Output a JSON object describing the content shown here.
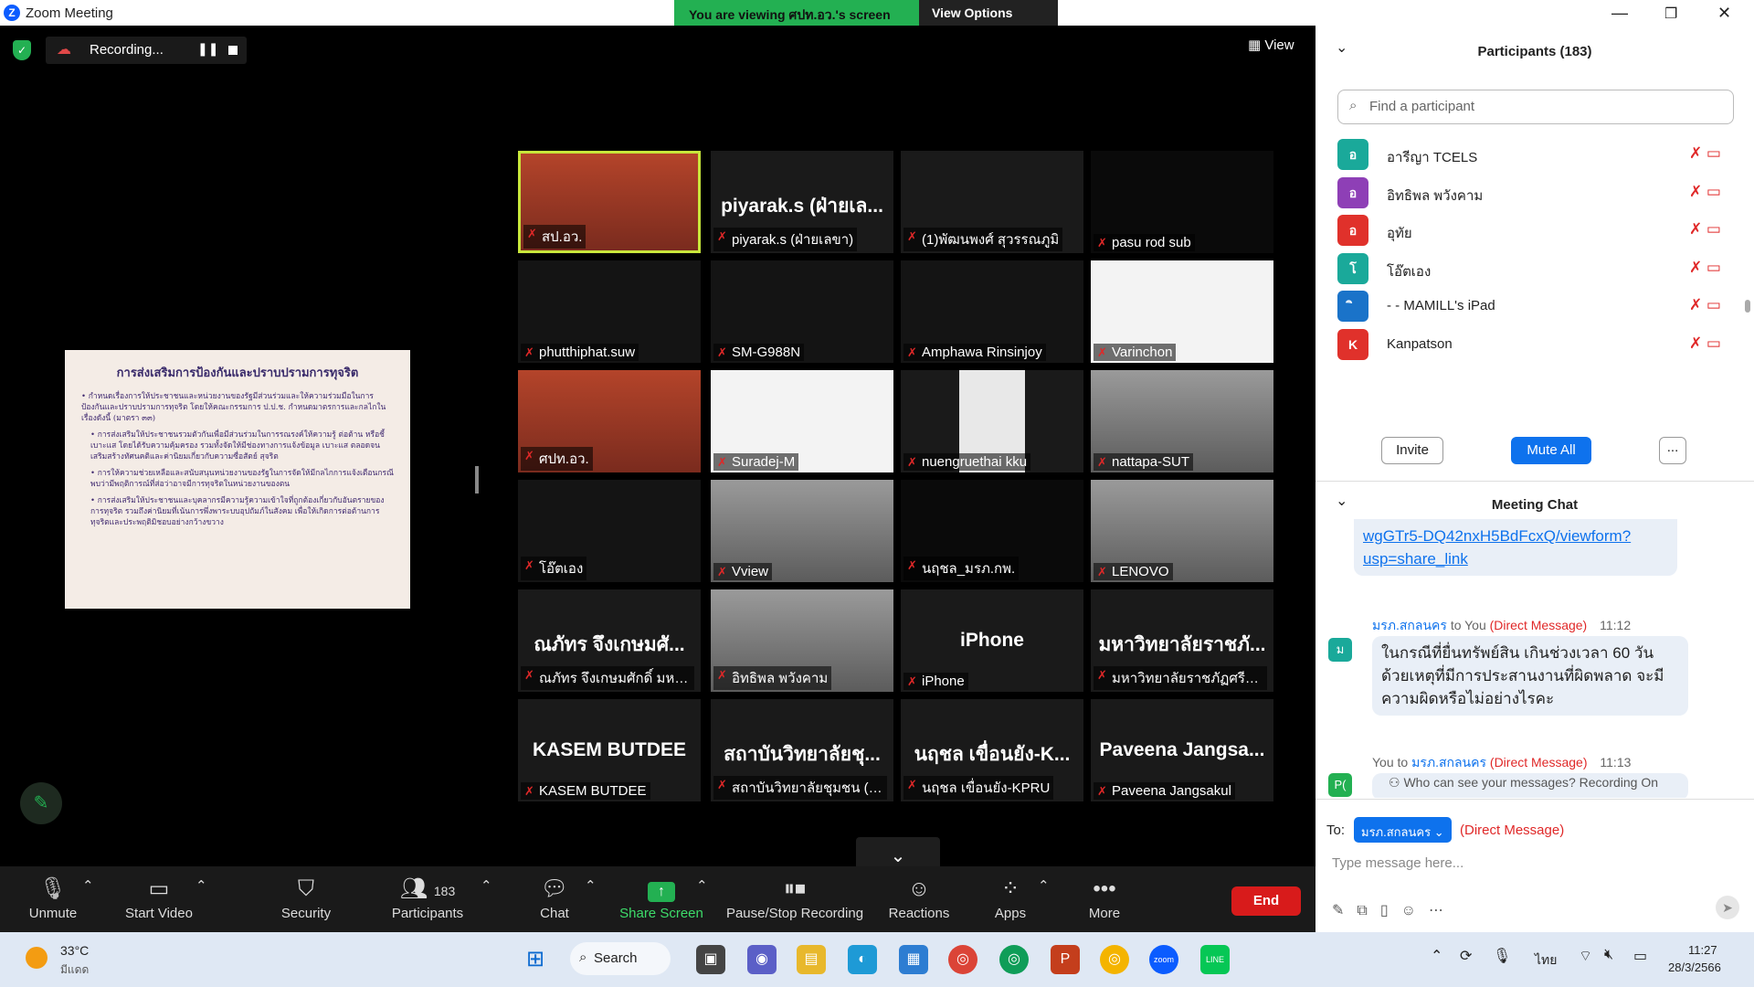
{
  "window": {
    "title": "Zoom Meeting",
    "banner": "You are viewing ศปท.อว.'s screen",
    "view_options": "View Options"
  },
  "recording": {
    "label": "Recording..."
  },
  "view_label": "View",
  "slide": {
    "title": "การส่งเสริมการป้องกันและปราบปรามการทุจริต",
    "lines": [
      "• กำหนดเรื่องการให้ประชาชนและหน่วยงานของรัฐมีส่วนร่วมและให้ความร่วมมือในการป้องกันและปราบปรามการทุจริต โดยให้คณะกรรมการ ป.ป.ช. กำหนดมาตรการและกลไกในเรื่องดังนี้ (มาตรา ๓๓)",
      "• การส่งเสริมให้ประชาชนรวมตัวกันเพื่อมีส่วนร่วมในการรณรงค์ให้ความรู้ ต่อต้าน หรือชี้เบาะแส โดยได้รับความคุ้มครอง รวมทั้งจัดให้มีช่องทางการแจ้งข้อมูล เบาะแส ตลอดจนเสริมสร้างทัศนคติและค่านิยมเกี่ยวกับความซื่อสัตย์ สุจริต",
      "• การให้ความช่วยเหลือและสนับสนุนหน่วยงานของรัฐในการจัดให้มีกลไกการแจ้งเตือนกรณีพบว่ามีพฤติการณ์ที่ส่อว่าอาจมีการทุจริตในหน่วยงานของตน",
      "• การส่งเสริมให้ประชาชนและบุคลากรมีความรู้ความเข้าใจที่ถูกต้องเกี่ยวกับอันตรายของการทุจริต รวมถึงค่านิยมที่เน้นการพึ่งพาระบบอุปถัมภ์ในสังคม เพื่อให้เกิดการต่อต้านการทุจริตและประพฤติมิชอบอย่างกว้างขวาง"
    ]
  },
  "tiles": [
    {
      "big": "",
      "name": "สป.อว.",
      "kind": "video-red"
    },
    {
      "big": "piyarak.s (ฝ่ายเล...",
      "name": "piyarak.s (ฝ่ายเลขา)"
    },
    {
      "big": "",
      "name": "(1)พัฒนพงศ์ สุวรรณภูมิ"
    },
    {
      "big": "",
      "name": "pasu rod sub",
      "kind": "black"
    },
    {
      "big": "",
      "name": "phutthiphat.suw",
      "kind": "dark"
    },
    {
      "big": "",
      "name": "SM-G988N",
      "kind": "dark"
    },
    {
      "big": "",
      "name": "Amphawa Rinsinjoy",
      "kind": "dark"
    },
    {
      "big": "",
      "name": "Varinchon",
      "kind": "white"
    },
    {
      "big": "",
      "name": "ศปท.อว.",
      "kind": "video-red"
    },
    {
      "big": "",
      "name": "Suradej-M",
      "kind": "white"
    },
    {
      "big": "",
      "name": "nuengruethai kku",
      "kind": "photo"
    },
    {
      "big": "",
      "name": "nattapa-SUT",
      "kind": "room"
    },
    {
      "big": "",
      "name": "โอ๊ตเอง",
      "kind": "dark"
    },
    {
      "big": "",
      "name": "Vview",
      "kind": "room"
    },
    {
      "big": "",
      "name": "นฤชล_มรภ.กพ.",
      "kind": "black"
    },
    {
      "big": "",
      "name": "LENOVO",
      "kind": "room"
    },
    {
      "big": "ณภัทร จึงเกษมศั...",
      "name": "ณภัทร จึงเกษมศักดิ์ มหาวิ..."
    },
    {
      "big": "",
      "name": "อิทธิพล พวังคาม",
      "kind": "room"
    },
    {
      "big": "iPhone",
      "name": "iPhone"
    },
    {
      "big": "มหาวิทยาลัยราชภั...",
      "name": "มหาวิทยาลัยราชภัฏศรีสะ..."
    },
    {
      "big": "KASEM BUTDEE",
      "name": "KASEM BUTDEE"
    },
    {
      "big": "สถาบันวิทยาลัยชุ...",
      "name": "สถาบันวิทยาลัยชุมชน (นา..."
    },
    {
      "big": "นฤชล เขื่อนยัง-K...",
      "name": "นฤชล เขื่อนยัง-KPRU"
    },
    {
      "big": "Paveena Jangsa...",
      "name": "Paveena Jangsakul"
    }
  ],
  "toolbar": {
    "unmute": "Unmute",
    "start_video": "Start Video",
    "security": "Security",
    "participants": "Participants",
    "participants_count": "183",
    "chat": "Chat",
    "share_screen": "Share Screen",
    "pause_recording": "Pause/Stop Recording",
    "reactions": "Reactions",
    "apps": "Apps",
    "more": "More",
    "end": "End"
  },
  "participants_panel": {
    "title": "Participants (183)",
    "search_placeholder": "Find a participant",
    "items": [
      {
        "initial": "อ",
        "name": "อารีญา TCELS",
        "color": "#1aa99a"
      },
      {
        "initial": "อ",
        "name": "อิทธิพล พวังคาม",
        "color": "#8e3fb6"
      },
      {
        "initial": "อ",
        "name": "อุทัย",
        "color": "#e0312b"
      },
      {
        "initial": "โ",
        "name": "โอ๊ตเอง",
        "color": "#1aa99a"
      },
      {
        "initial": "ิ",
        "name": "- - MAMILL's iPad",
        "color": "#1a73c9"
      },
      {
        "initial": "K",
        "name": "Kanpatson",
        "color": "#e0312b"
      }
    ],
    "invite": "Invite",
    "mute_all": "Mute All",
    "more": "..."
  },
  "chat": {
    "title": "Meeting Chat",
    "link_lines": [
      "wgGTr5-DQ42nxH5BdFcxQ/viewform?",
      "usp=share_link"
    ],
    "msg1": {
      "sender": "มรภ.สกลนคร",
      "to": "to You",
      "dm": "(Direct Message)",
      "time": "11:12",
      "initial": "ม",
      "text": "ในกรณีที่ยื่นทรัพย์สิน เกินช่วงเวลา 60 วัน ด้วยเหตุที่มีการประสานงานที่ผิดพลาด จะมีความผิดหรือไม่อย่างไรคะ"
    },
    "msg2": {
      "from": "You to",
      "recipient": "มรภ.สกลนคร",
      "dm": "(Direct Message)",
      "time": "11:13",
      "initial": "P("
    },
    "privacy": "Who can see your messages? Recording On",
    "to_label": "To:",
    "to_value": "มรภ.สกลนคร",
    "to_dm": "(Direct Message)",
    "input_placeholder": "Type message here..."
  },
  "taskbar": {
    "temp": "33°C",
    "weather": "มีแดด",
    "search": "Search",
    "lang": "ไทย",
    "time": "11:27",
    "date": "28/3/2566"
  }
}
